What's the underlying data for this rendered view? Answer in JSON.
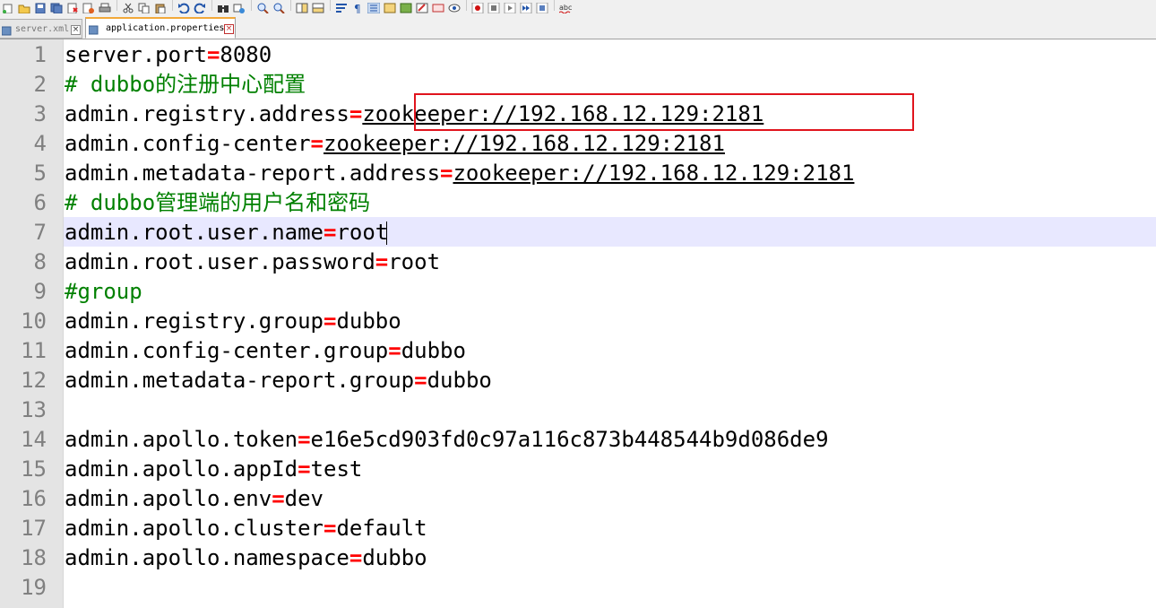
{
  "tabs": [
    {
      "label": "server.xml",
      "close": "×",
      "active": false
    },
    {
      "label": "application.properties",
      "close": "×",
      "active": true
    }
  ],
  "toolbar": {
    "icons": [
      "new-file-icon",
      "open-file-icon",
      "save-icon",
      "save-all-icon",
      "close-icon",
      "close-all-icon",
      "print-icon",
      "cut-icon",
      "copy-icon",
      "paste-icon",
      "undo-icon",
      "redo-icon",
      "find-icon",
      "replace-icon",
      "zoom-in-icon",
      "zoom-out-icon",
      "sync-vertical-icon",
      "sync-horizontal-icon",
      "word-wrap-icon",
      "show-all-chars-icon",
      "indent-guide-icon",
      "document-map-icon",
      "function-list-icon",
      "folder-workspace-icon",
      "monitor-icon",
      "macro-record-icon",
      "macro-stop-icon",
      "macro-play-icon",
      "macro-run-multiple-icon",
      "macro-save-icon",
      "spell-check-icon"
    ]
  },
  "editor": {
    "current_line": 7,
    "lines": [
      {
        "num": "1",
        "type": "kv",
        "key": "server.port",
        "eq": "=",
        "value": "8080"
      },
      {
        "num": "2",
        "type": "comment",
        "text": "# dubbo的注册中心配置"
      },
      {
        "num": "3",
        "type": "kv",
        "key": "admin.registry.address",
        "eq": "=",
        "value": "zookeeper://192.168.12.129:2181",
        "url": true
      },
      {
        "num": "4",
        "type": "kv",
        "key": "admin.config-center",
        "eq": "=",
        "value": "zookeeper://192.168.12.129:2181",
        "url": true
      },
      {
        "num": "5",
        "type": "kv",
        "key": "admin.metadata-report.address",
        "eq": "=",
        "value": "zookeeper://192.168.12.129:2181",
        "url": true
      },
      {
        "num": "6",
        "type": "comment",
        "text": "# dubbo管理端的用户名和密码"
      },
      {
        "num": "7",
        "type": "kv",
        "key": "admin.root.user.name",
        "eq": "=",
        "value": "root"
      },
      {
        "num": "8",
        "type": "kv",
        "key": "admin.root.user.password",
        "eq": "=",
        "value": "root"
      },
      {
        "num": "9",
        "type": "comment",
        "text": "#group"
      },
      {
        "num": "10",
        "type": "kv",
        "key": "admin.registry.group",
        "eq": "=",
        "value": "dubbo"
      },
      {
        "num": "11",
        "type": "kv",
        "key": "admin.config-center.group",
        "eq": "=",
        "value": "dubbo"
      },
      {
        "num": "12",
        "type": "kv",
        "key": "admin.metadata-report.group",
        "eq": "=",
        "value": "dubbo"
      },
      {
        "num": "13",
        "type": "empty"
      },
      {
        "num": "14",
        "type": "kv",
        "key": "admin.apollo.token",
        "eq": "=",
        "value": "e16e5cd903fd0c97a116c873b448544b9d086de9"
      },
      {
        "num": "15",
        "type": "kv",
        "key": "admin.apollo.appId",
        "eq": "=",
        "value": "test"
      },
      {
        "num": "16",
        "type": "kv",
        "key": "admin.apollo.env",
        "eq": "=",
        "value": "dev"
      },
      {
        "num": "17",
        "type": "kv",
        "key": "admin.apollo.cluster",
        "eq": "=",
        "value": "default"
      },
      {
        "num": "18",
        "type": "kv",
        "key": "admin.apollo.namespace",
        "eq": "=",
        "value": "dubbo"
      },
      {
        "num": "19",
        "type": "empty"
      }
    ]
  },
  "colors": {
    "comment": "#008000",
    "operator": "#ff0000",
    "highlight_box": "#e0141d",
    "current_line": "#e8e8ff",
    "line_number": "#808080",
    "active_tab_accent": "#f2a93a"
  }
}
